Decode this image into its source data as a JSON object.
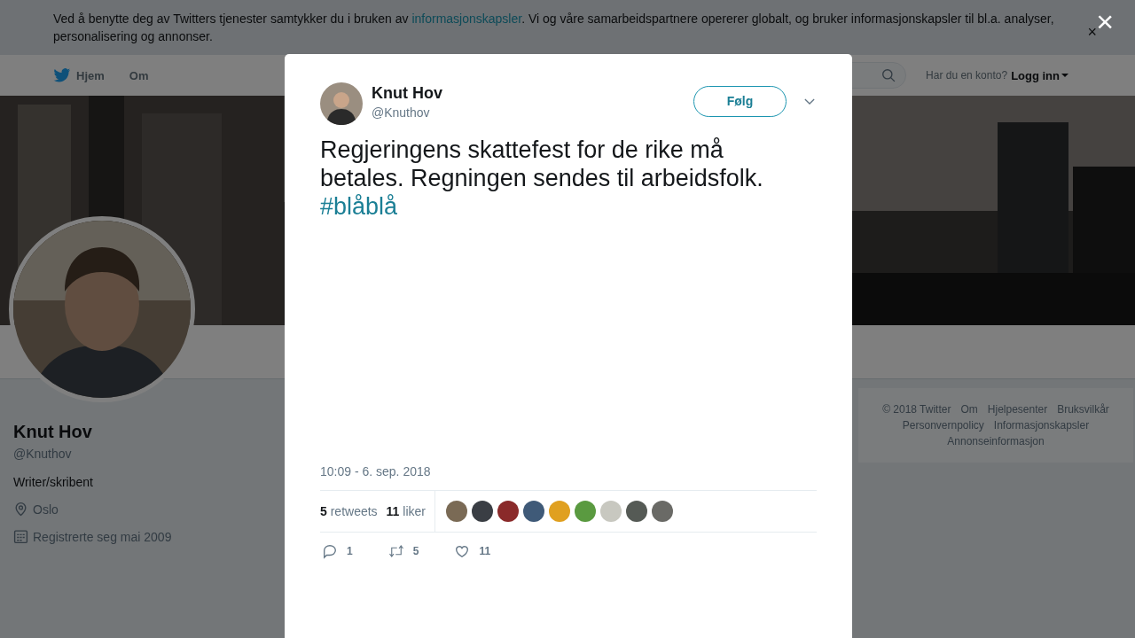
{
  "cookie_banner": {
    "text_before": "Ved å benytte deg av Twitters tjenester samtykker du i bruken av ",
    "link": "informasjonskapsler",
    "text_after": ". Vi og våre samarbeidspartnere opererer globalt, og bruker informasjonskapsler til bl.a. analyser, personalisering og annonser.",
    "close": "×"
  },
  "nav": {
    "items": [
      {
        "label": "Hjem",
        "kind": "home"
      },
      {
        "label": "Om",
        "kind": "plain"
      }
    ],
    "login_prompt": "Har du en konto?",
    "login_link": "Logg inn"
  },
  "profile": {
    "name": "Knut Hov",
    "handle": "@Knuthov",
    "bio": "Writer/skribent",
    "location": "Oslo",
    "joined": "Registrerte seg mai 2009"
  },
  "footer": {
    "links": [
      "© 2018 Twitter",
      "Om",
      "Hjelpesenter",
      "Bruksvilkår",
      "Personvernpolicy",
      "Informasjonskapsler",
      "Annonseinformasjon"
    ]
  },
  "modal_close": "×",
  "tweet": {
    "author": "Knut Hov",
    "handle": "@Knuthov",
    "follow_button": "Følg",
    "text": "Regjeringens skattefest for de rike må betales. Regningen sendes til arbeidsfolk.",
    "hashtag": "#blåblå",
    "time": "10:09 - 6. sep. 2018",
    "retweets": {
      "count": "5",
      "label": "retweets"
    },
    "likes": {
      "count": "11",
      "label": "liker"
    },
    "likers": [
      {
        "color": "#7a6a55"
      },
      {
        "color": "#3a3e44"
      },
      {
        "color": "#8a2a2a"
      },
      {
        "color": "#3f5a78"
      },
      {
        "color": "#e0a020"
      },
      {
        "color": "#5a9a40"
      },
      {
        "color": "#c8c8c0"
      },
      {
        "color": "#555a55"
      },
      {
        "color": "#6a6a66"
      }
    ],
    "actions": [
      {
        "kind": "reply",
        "count": "1"
      },
      {
        "kind": "retweet",
        "count": "5"
      },
      {
        "kind": "like",
        "count": "11"
      }
    ]
  }
}
